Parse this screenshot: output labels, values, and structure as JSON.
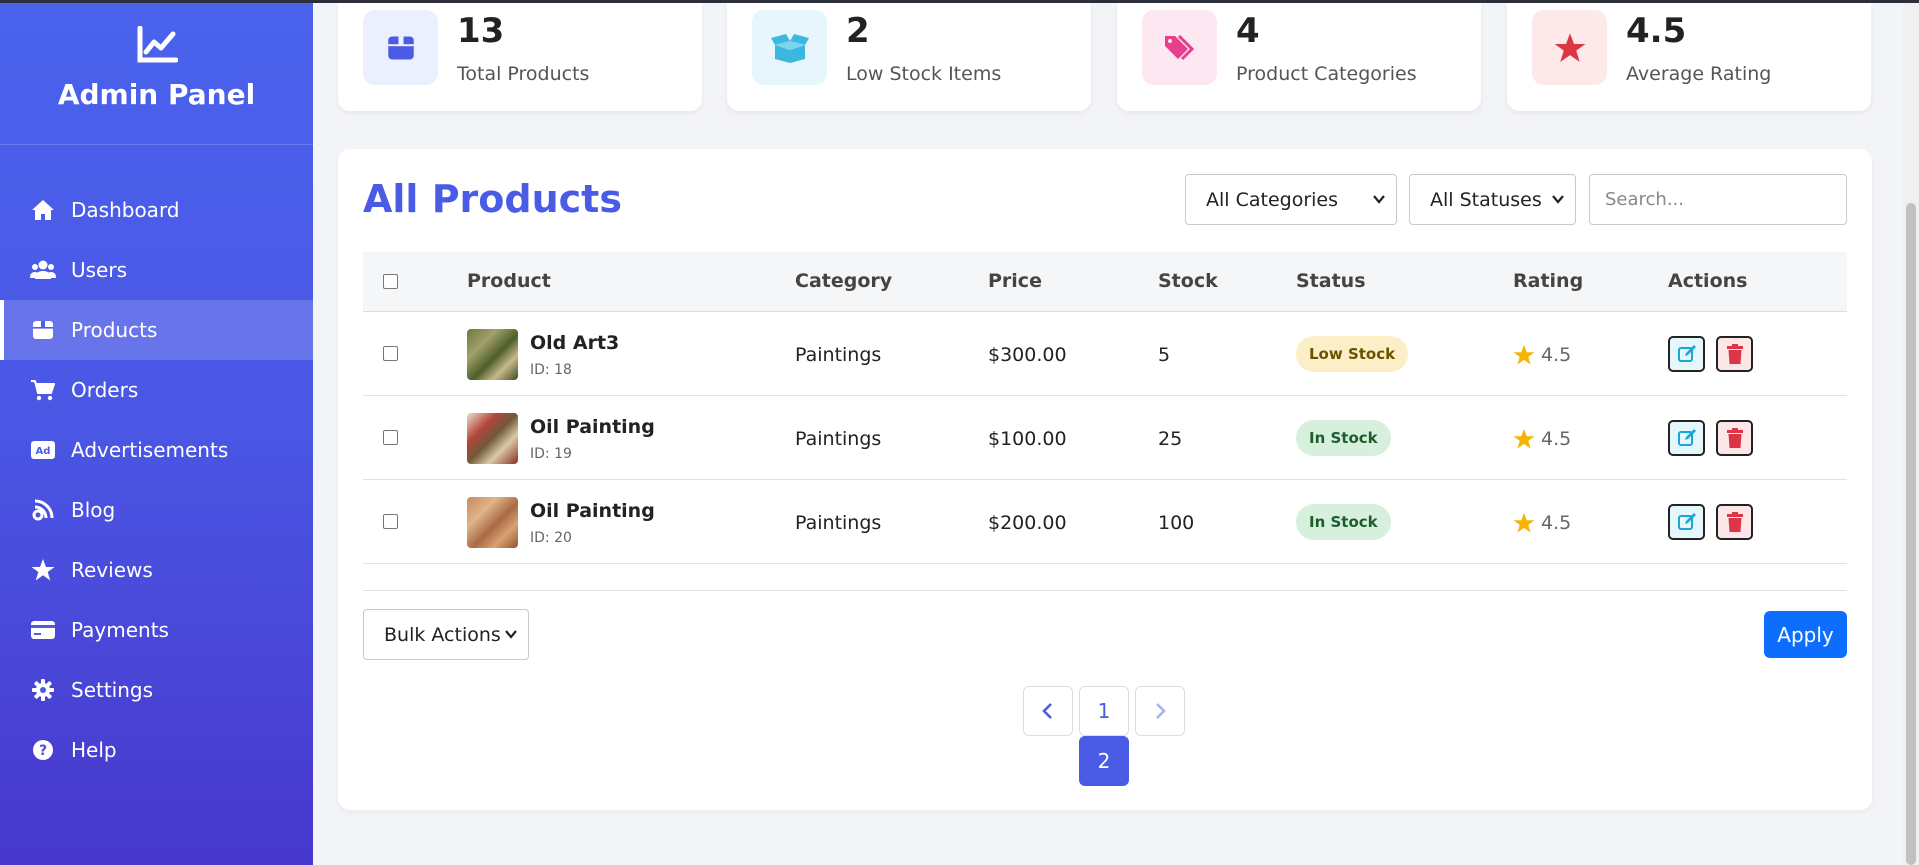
{
  "sidebar": {
    "title": "Admin Panel",
    "items": [
      {
        "label": "Dashboard",
        "icon": "home-icon"
      },
      {
        "label": "Users",
        "icon": "users-icon"
      },
      {
        "label": "Products",
        "icon": "box-icon",
        "active": true
      },
      {
        "label": "Orders",
        "icon": "cart-icon"
      },
      {
        "label": "Advertisements",
        "icon": "ad-icon"
      },
      {
        "label": "Blog",
        "icon": "blog-icon"
      },
      {
        "label": "Reviews",
        "icon": "star-icon"
      },
      {
        "label": "Payments",
        "icon": "credit-card-icon"
      },
      {
        "label": "Settings",
        "icon": "gear-icon"
      },
      {
        "label": "Help",
        "icon": "question-icon"
      }
    ]
  },
  "stats": [
    {
      "value": "13",
      "label": "Total Products",
      "icon": "box-icon",
      "color": "#4a5ce6",
      "bg": "#eceffe"
    },
    {
      "value": "2",
      "label": "Low Stock Items",
      "icon": "open-box-icon",
      "color": "#3cb7e0",
      "bg": "#e6f6fc"
    },
    {
      "value": "4",
      "label": "Product Categories",
      "icon": "tags-icon",
      "color": "#e83e8c",
      "bg": "#fde7f0"
    },
    {
      "value": "4.5",
      "label": "Average Rating",
      "icon": "star-icon",
      "color": "#dc3545",
      "bg": "#fde8ea"
    }
  ],
  "products": {
    "title": "All Products",
    "category_filter": "All Categories",
    "status_filter": "All Statuses",
    "search_placeholder": "Search...",
    "columns": [
      "Product",
      "Category",
      "Price",
      "Stock",
      "Status",
      "Rating",
      "Actions"
    ],
    "rows": [
      {
        "name": "Old Art3",
        "id": "ID: 18",
        "category": "Paintings",
        "price": "$300.00",
        "stock": "5",
        "status": "Low Stock",
        "rating": "4.5"
      },
      {
        "name": "Oil Painting",
        "id": "ID: 19",
        "category": "Paintings",
        "price": "$100.00",
        "stock": "25",
        "status": "In Stock",
        "rating": "4.5"
      },
      {
        "name": "Oil Painting",
        "id": "ID: 20",
        "category": "Paintings",
        "price": "$200.00",
        "stock": "100",
        "status": "In Stock",
        "rating": "4.5"
      }
    ],
    "bulk_actions": "Bulk Actions",
    "apply_label": "Apply",
    "pages": [
      "1",
      "2"
    ],
    "current_page": "2"
  },
  "colors": {
    "accent": "#4a5ce6",
    "apply_button": "#0d6efd",
    "rating_star": "#f5b400",
    "edit_icon": "#1aa6d6",
    "delete_icon": "#dc3545"
  }
}
